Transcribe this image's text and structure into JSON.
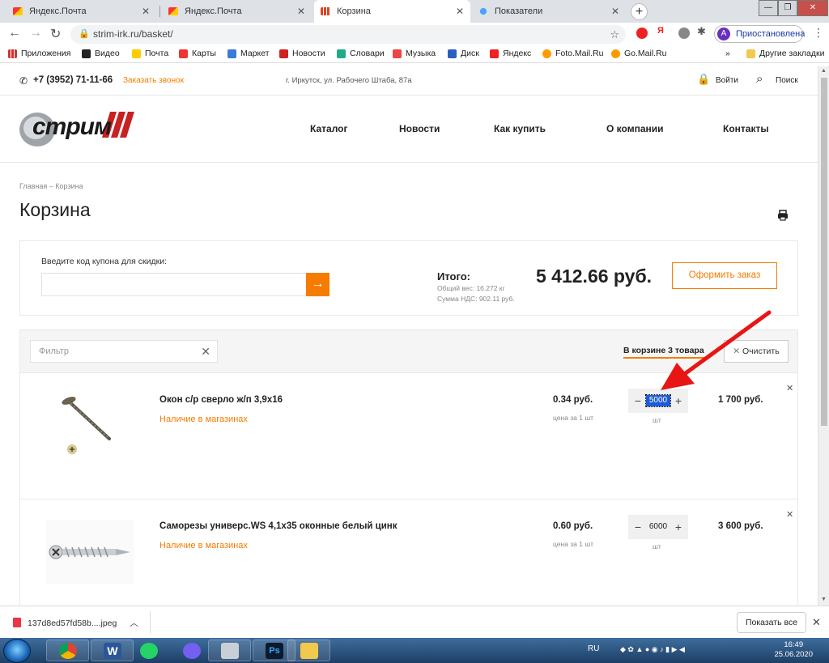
{
  "browser": {
    "tabs": [
      {
        "title": "Яндекс.Почта",
        "icon": "yandex-mail-icon"
      },
      {
        "title": "Яндекс.Почта",
        "icon": "yandex-mail-icon"
      },
      {
        "title": "Корзина",
        "icon": "strim-icon",
        "active": true
      },
      {
        "title": "Показатели",
        "icon": "drops-icon"
      }
    ],
    "url": "strim-irk.ru/basket/",
    "profile": {
      "initial": "A",
      "status": "Приостановлена"
    },
    "bookmarks": [
      "Приложения",
      "Видео",
      "Почта",
      "Карты",
      "Маркет",
      "Новости",
      "Словари",
      "Музыка",
      "Диск",
      "Яндекс",
      "Foto.Mail.Ru",
      "Go.Mail.Ru"
    ],
    "bookmarks_more": "»",
    "other_bookmarks": "Другие закладки"
  },
  "header": {
    "phone": "+7 (3952) 71-11-66",
    "callback": "Заказать звонок",
    "address": "г. Иркутск, ул. Рабочего Штаба, 87а",
    "login": "Войти",
    "search": "Поиск",
    "logo_text": "стрим",
    "nav": [
      "Каталог",
      "Новости",
      "Как купить",
      "О компании",
      "Контакты"
    ]
  },
  "breadcrumb": {
    "home": "Главная",
    "sep": "–",
    "current": "Корзина"
  },
  "page_title": "Корзина",
  "coupon": {
    "label": "Введите код купона для скидки:",
    "value": "",
    "apply": "→"
  },
  "summary": {
    "total_label": "Итого:",
    "weight": "Общий вес: 16.272 кг",
    "nds": "Сумма НДС: 902.11 руб.",
    "total": "5 412.66 руб.",
    "order": "Оформить заказ"
  },
  "basket": {
    "filter_placeholder": "Фильтр",
    "count_label": "В корзине 3 товара",
    "clear": "Очистить",
    "items": [
      {
        "name": "Окон с/р сверло ж/п 3,9х16",
        "stock": "Наличие в магазинах",
        "price": "0.34 руб.",
        "unit": "цена за 1 шт",
        "qty": "5000",
        "qty_unit": "шт",
        "sum": "1 700 руб.",
        "selected": true
      },
      {
        "name": "Саморезы универс.WS 4,1х35 оконные белый цинк",
        "stock": "Наличие в магазинах",
        "price": "0.60 руб.",
        "unit": "цена за 1 шт",
        "qty": "6000",
        "qty_unit": "шт",
        "sum": "3 600 руб.",
        "selected": false
      }
    ]
  },
  "download": {
    "file": "137d8ed57fd58b....jpeg",
    "show_all": "Показать все"
  },
  "taskbar": {
    "lang": "RU",
    "time": "16:49",
    "date": "25.06.2020"
  },
  "colors": {
    "accent": "#f57c00",
    "annotation_arrow": "#e81515",
    "selection": "#1e5bd8"
  }
}
